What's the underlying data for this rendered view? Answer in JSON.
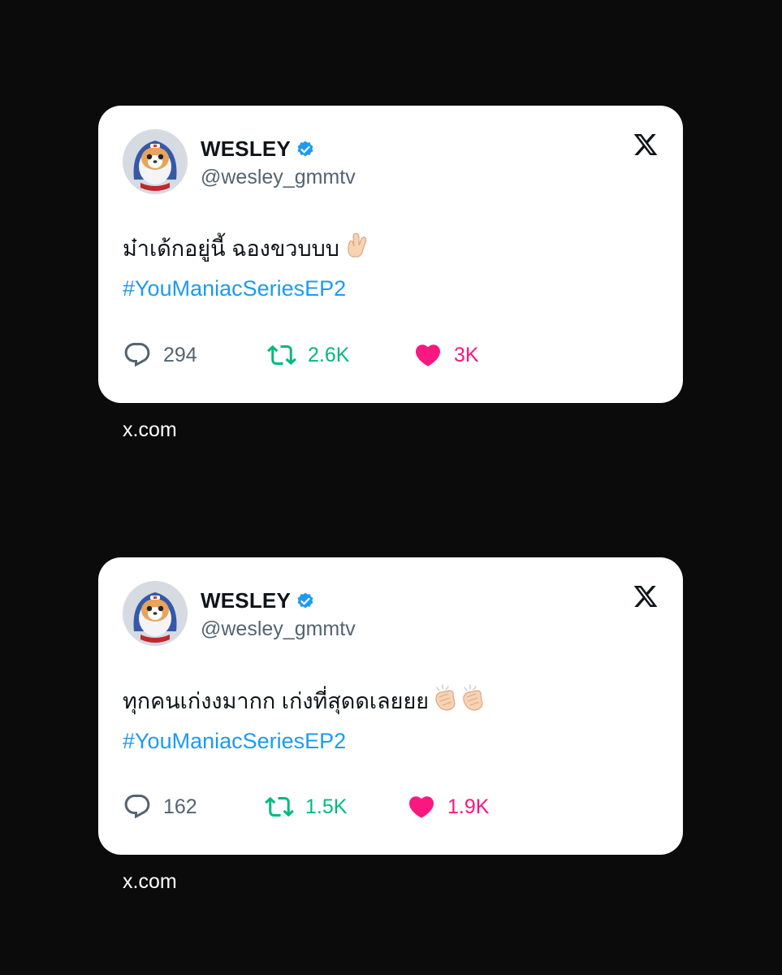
{
  "tweets": [
    {
      "name": "WESLEY",
      "handle": "@wesley_gmmtv",
      "text": "ม๋าเด้กอยู่นี้ ฉองขวบบบ",
      "hashtag": "#YouManiacSeriesEP2",
      "emoji": "crossed-fingers-emoji",
      "replies": "294",
      "retweets": "2.6K",
      "likes": "3K",
      "source": "x.com"
    },
    {
      "name": "WESLEY",
      "handle": "@wesley_gmmtv",
      "text": "ทุกคนเก่งงมากก เก่งที่สุดดเลยยย",
      "hashtag": "#YouManiacSeriesEP2",
      "emoji": "clapping-hands-emoji",
      "replies": "162",
      "retweets": "1.5K",
      "likes": "1.9K",
      "source": "x.com"
    }
  ],
  "colors": {
    "background": "#0b0b0b",
    "card": "#ffffff",
    "hashtag": "#1d9bf0",
    "retweet": "#00ba7c",
    "like": "#f91880",
    "muted": "#536471",
    "verified": "#1d9bf0"
  },
  "icons": [
    "verified-badge-icon",
    "x-logo-icon",
    "reply-icon",
    "retweet-icon",
    "heart-icon"
  ]
}
